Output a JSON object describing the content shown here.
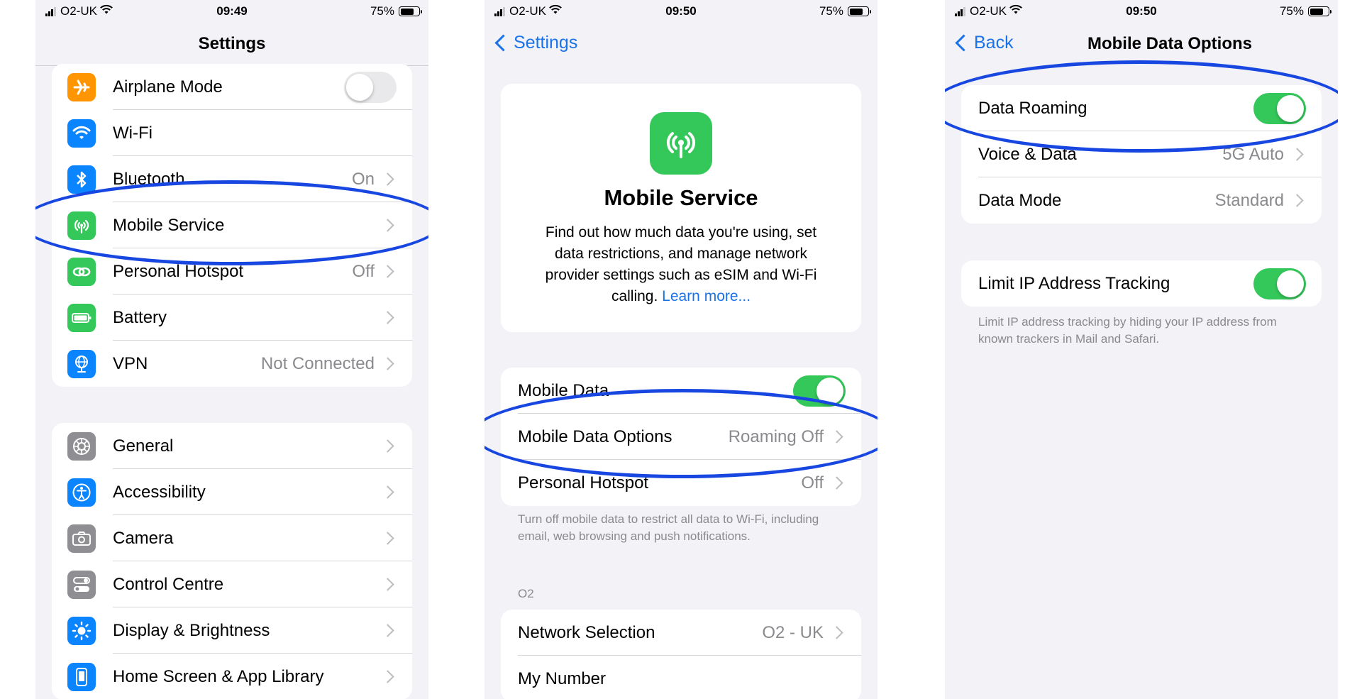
{
  "status": {
    "carrier": "O2-UK",
    "battery": "75%",
    "time_1": "09:49",
    "time_2": "09:50",
    "time_3": "09:50"
  },
  "screen1": {
    "title": "Settings",
    "group1": [
      {
        "label": "Airplane Mode",
        "icon": "airplane-icon",
        "color": "#ff9500",
        "toggle": "off"
      },
      {
        "label": "Wi-Fi",
        "icon": "wifi-icon",
        "color": "#0a84ff"
      },
      {
        "label": "Bluetooth",
        "value": "On",
        "icon": "bluetooth-icon",
        "color": "#0a84ff"
      },
      {
        "label": "Mobile Service",
        "icon": "antenna-icon",
        "color": "#34c759"
      },
      {
        "label": "Personal Hotspot",
        "value": "Off",
        "icon": "hotspot-icon",
        "color": "#34c759"
      },
      {
        "label": "Battery",
        "icon": "battery-icon",
        "color": "#34c759"
      },
      {
        "label": "VPN",
        "value": "Not Connected",
        "icon": "globe-icon",
        "color": "#0a84ff"
      }
    ],
    "group2": [
      {
        "label": "General",
        "icon": "gear-icon",
        "color": "#8e8e93"
      },
      {
        "label": "Accessibility",
        "icon": "accessibility-icon",
        "color": "#0a84ff"
      },
      {
        "label": "Camera",
        "icon": "camera-icon",
        "color": "#8e8e93"
      },
      {
        "label": "Control Centre",
        "icon": "switches-icon",
        "color": "#8e8e93"
      },
      {
        "label": "Display & Brightness",
        "icon": "sun-icon",
        "color": "#0a84ff"
      },
      {
        "label": "Home Screen & App Library",
        "icon": "phone-icon",
        "color": "#0a84ff"
      }
    ]
  },
  "screen2": {
    "back": "Settings",
    "card_title": "Mobile Service",
    "card_desc": "Find out how much data you're using, set data restrictions, and manage network provider settings such as eSIM and Wi-Fi calling.",
    "card_link": "Learn more...",
    "rows": [
      {
        "label": "Mobile Data",
        "toggle": "on"
      },
      {
        "label": "Mobile Data Options",
        "value": "Roaming Off"
      },
      {
        "label": "Personal Hotspot",
        "value": "Off"
      }
    ],
    "footnote": "Turn off mobile data to restrict all data to Wi-Fi, including email, web browsing and push notifications.",
    "section_header": "O2",
    "rows2": [
      {
        "label": "Network Selection",
        "value": "O2 - UK"
      },
      {
        "label": "My Number"
      }
    ]
  },
  "screen3": {
    "back": "Back",
    "title": "Mobile Data Options",
    "rows": [
      {
        "label": "Data Roaming",
        "toggle": "on"
      },
      {
        "label": "Voice & Data",
        "value": "5G Auto"
      },
      {
        "label": "Data Mode",
        "value": "Standard"
      }
    ],
    "rows2": [
      {
        "label": "Limit IP Address Tracking",
        "toggle": "on"
      }
    ],
    "footnote": "Limit IP address tracking by hiding your IP address from known trackers in Mail and Safari."
  },
  "accent": "#1a73e8",
  "annotation_color": "#1747e0"
}
